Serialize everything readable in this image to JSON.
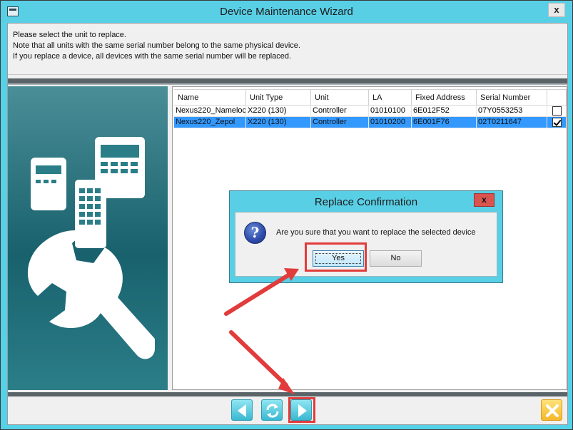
{
  "window": {
    "title": "Device Maintenance Wizard",
    "close_label": "x"
  },
  "instructions": [
    "Please select the unit to replace.",
    "Note that all units with the same serial number belong to the same physical device.",
    "If you replace a device, all devices with the same serial number will be replaced."
  ],
  "table": {
    "columns": [
      "Name",
      "Unit Type",
      "Unit",
      "LA",
      "Fixed Address",
      "Serial Number",
      ""
    ],
    "rows": [
      {
        "name": "Nexus220_Nameloc",
        "unit_type": "X220 (130)",
        "unit": "Controller",
        "la": "01010100",
        "fixed_address": "6E012F52",
        "serial_number": "07Y0553253",
        "checked": false,
        "selected": false
      },
      {
        "name": "Nexus220_Zepol",
        "unit_type": "X220 (130)",
        "unit": "Controller",
        "la": "01010200",
        "fixed_address": "6E001F76",
        "serial_number": "02T0211647",
        "checked": true,
        "selected": true
      }
    ]
  },
  "dialog": {
    "title": "Replace Confirmation",
    "close_label": "x",
    "message": "Are you sure that you want to replace the selected device",
    "icon": "question-icon",
    "yes_label": "Yes",
    "no_label": "No"
  },
  "footer": {
    "buttons": [
      {
        "name": "back-button",
        "icon": "arrow-left-icon"
      },
      {
        "name": "refresh-button",
        "icon": "refresh-icon"
      },
      {
        "name": "next-button",
        "icon": "arrow-right-icon"
      },
      {
        "name": "cancel-button",
        "icon": "close-x-icon"
      }
    ]
  },
  "colors": {
    "title_bar": "#59cfe6",
    "selected_row": "#3399ff",
    "annotation": "#e23b3b",
    "side_panel": "#18616d"
  }
}
